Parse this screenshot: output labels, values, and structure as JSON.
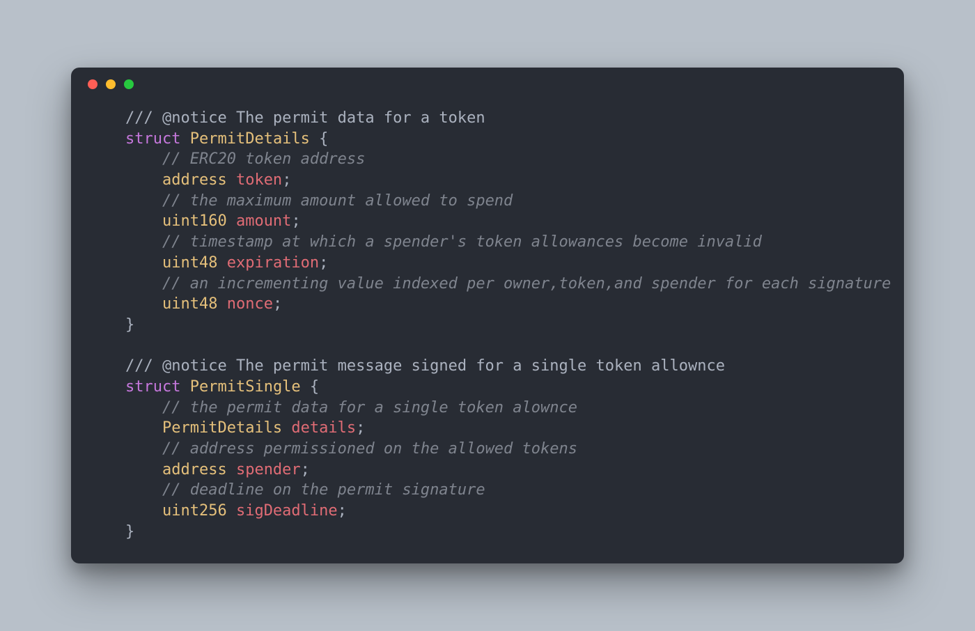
{
  "colors": {
    "bg": "#b8c0c9",
    "window": "#282c34",
    "dot_red": "#ff5f56",
    "dot_yellow": "#ffbd2e",
    "dot_green": "#27c93f",
    "comment": "#7f848e",
    "keyword": "#c678dd",
    "type": "#e5c07b",
    "name": "#e06c75",
    "text": "#abb2bf"
  },
  "code": {
    "l1": "/// @notice The permit data for a token",
    "l2_kw": "struct",
    "l2_name": "PermitDetails",
    "l2_brace": " {",
    "l3": "// ERC20 token address",
    "l4_type": "address",
    "l4_name": "token",
    "l4_semi": ";",
    "l5": "// the maximum amount allowed to spend",
    "l6_type": "uint160",
    "l6_name": "amount",
    "l6_semi": ";",
    "l7": "// timestamp at which a spender's token allowances become invalid",
    "l8_type": "uint48",
    "l8_name": "expiration",
    "l8_semi": ";",
    "l9": "// an incrementing value indexed per owner,token,and spender for each signature",
    "l10_type": "uint48",
    "l10_name": "nonce",
    "l10_semi": ";",
    "l11": "}",
    "l13": "/// @notice The permit message signed for a single token allownce",
    "l14_kw": "struct",
    "l14_name": "PermitSingle",
    "l14_brace": " {",
    "l15": "// the permit data for a single token alownce",
    "l16_type": "PermitDetails",
    "l16_name": "details",
    "l16_semi": ";",
    "l17": "// address permissioned on the allowed tokens",
    "l18_type": "address",
    "l18_name": "spender",
    "l18_semi": ";",
    "l19": "// deadline on the permit signature",
    "l20_type": "uint256",
    "l20_name": "sigDeadline",
    "l20_semi": ";",
    "l21": "}"
  }
}
